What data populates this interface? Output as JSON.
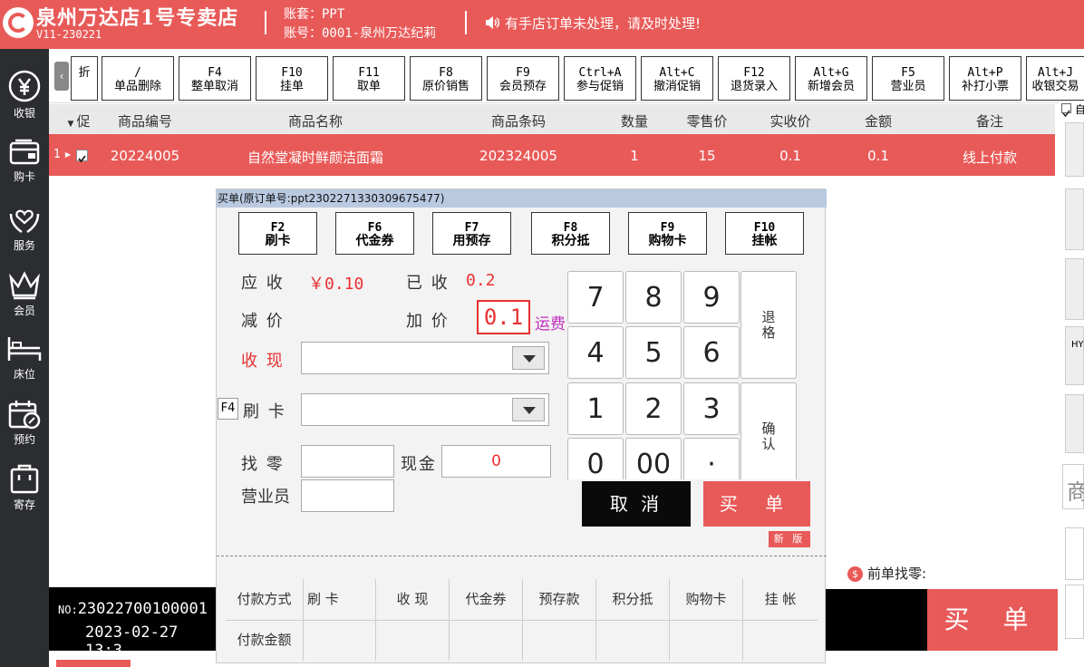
{
  "header": {
    "store_name": "泉州万达店1号专卖店",
    "version": "V11-230221",
    "account_set": "账套：PPT",
    "account_no": "账号：0001-泉州万达纪莉",
    "notice": "有手店订单未处理，请及时处理!"
  },
  "sidebar": {
    "items": [
      {
        "label": "收银",
        "icon": "yuan-coin-icon"
      },
      {
        "label": "购卡",
        "icon": "wallet-card-icon"
      },
      {
        "label": "服务",
        "icon": "hands-heart-icon"
      },
      {
        "label": "会员",
        "icon": "crown-icon"
      },
      {
        "label": "床位",
        "icon": "bed-icon"
      },
      {
        "label": "预约",
        "icon": "calendar-icon"
      },
      {
        "label": "寄存",
        "icon": "locker-icon"
      }
    ]
  },
  "function_keys": [
    {
      "key": "",
      "label": "折"
    },
    {
      "key": "/",
      "label": "单品删除"
    },
    {
      "key": "F4",
      "label": "整单取消"
    },
    {
      "key": "F10",
      "label": "挂单"
    },
    {
      "key": "F11",
      "label": "取单"
    },
    {
      "key": "F8",
      "label": "原价销售"
    },
    {
      "key": "F9",
      "label": "会员预存"
    },
    {
      "key": "Ctrl+A",
      "label": "参与促销"
    },
    {
      "key": "Alt+C",
      "label": "撤消促销"
    },
    {
      "key": "F12",
      "label": "退货录入"
    },
    {
      "key": "Alt+G",
      "label": "新增会员"
    },
    {
      "key": "F5",
      "label": "营业员"
    },
    {
      "key": "Alt+P",
      "label": "补打小票"
    },
    {
      "key": "Alt+J",
      "label": "收银交易"
    }
  ],
  "table": {
    "columns": [
      "促",
      "商品编号",
      "商品名称",
      "商品条码",
      "数量",
      "零售价",
      "实收价",
      "金额",
      "备注"
    ],
    "rows": [
      {
        "index": "1",
        "code": "20224005",
        "name": "自然堂凝时鲜颜洁面霜",
        "barcode": "202324005",
        "qty": "1",
        "retail": "15",
        "actual": "0.1",
        "amount": "0.1",
        "note": "线上付款"
      }
    ]
  },
  "dialog": {
    "title": "买单(原订单号:ppt2302271330309675477)",
    "pay_keys": [
      {
        "key": "F2",
        "label": "刷卡"
      },
      {
        "key": "F6",
        "label": "代金券"
      },
      {
        "key": "F7",
        "label": "用预存"
      },
      {
        "key": "F8",
        "label": "积分抵"
      },
      {
        "key": "F9",
        "label": "购物卡"
      },
      {
        "key": "F10",
        "label": "挂帐"
      }
    ],
    "receivable_label": "应 收",
    "receivable_value": "￥0.10",
    "received_label": "已 收",
    "received_value": "0.2",
    "discount_label": "减 价",
    "surcharge_label": "加 价",
    "surcharge_value": "0.1",
    "surcharge_note": "运费",
    "cash_label": "收 现",
    "card_hotkey": "F4",
    "card_label": "刷 卡",
    "change_label": "找 零",
    "cash_amount_label": "现金",
    "cash_amount_value": "0",
    "clerk_label": "营业员",
    "numpad": [
      "7",
      "8",
      "9",
      "4",
      "5",
      "6",
      "1",
      "2",
      "3",
      "0",
      "00",
      "·"
    ],
    "backspace_label": "退格",
    "confirm_label": "确认",
    "cancel_label": "取 消",
    "buy_label": "买 单",
    "new_badge": "新 版",
    "pay_table": {
      "row1": [
        "付款方式",
        "刷 卡",
        "收 现",
        "代金券",
        "预存款",
        "积分抵",
        "购物卡",
        "挂 帐"
      ],
      "row2_label": "付款金额"
    }
  },
  "bottom": {
    "order_no_prefix": "NO:",
    "order_no": "23022700100001",
    "datetime": "2023-02-27 13:3",
    "prev_change_label": "前单找零:",
    "buy_label": "买 单"
  },
  "right_partial": {
    "top_char": "自",
    "mid_text": "HY",
    "char2": "商"
  },
  "colors": {
    "brand_red": "#e85a58",
    "sidebar_dark": "#2b2d31",
    "highlight_red": "#e83131",
    "purple_note": "#c030c0"
  }
}
